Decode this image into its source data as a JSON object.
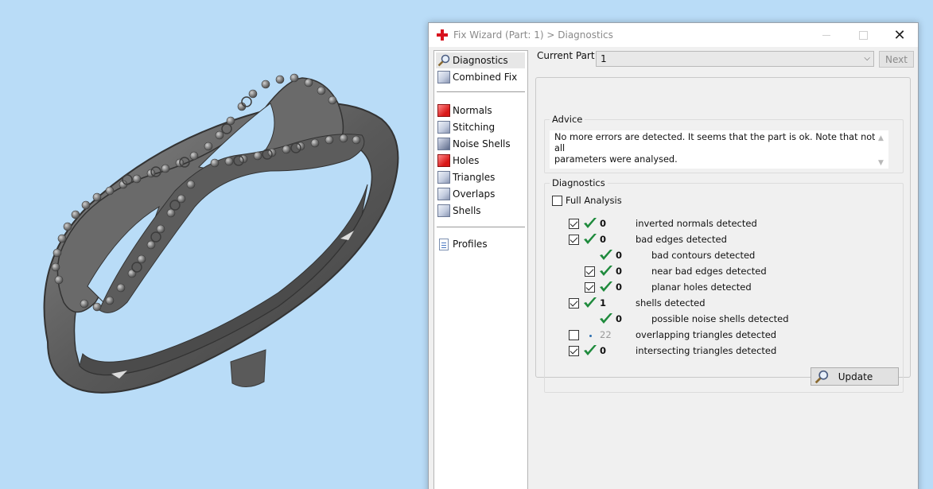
{
  "window": {
    "title": "Fix Wizard (Part: 1) > Diagnostics"
  },
  "nav": {
    "items": [
      {
        "label": "Diagnostics",
        "icon": "magnifier-icon",
        "selected": true
      },
      {
        "label": "Combined Fix",
        "icon": "cube-icon"
      },
      {
        "label": "Normals",
        "icon": "normals-cube-icon"
      },
      {
        "label": "Stitching",
        "icon": "stitching-cube-icon"
      },
      {
        "label": "Noise Shells",
        "icon": "noise-shells-icon"
      },
      {
        "label": "Holes",
        "icon": "holes-cube-icon"
      },
      {
        "label": "Triangles",
        "icon": "triangles-cube-icon"
      },
      {
        "label": "Overlaps",
        "icon": "overlaps-cube-icon"
      },
      {
        "label": "Shells",
        "icon": "shells-cube-icon"
      },
      {
        "label": "Profiles",
        "icon": "document-icon"
      }
    ]
  },
  "current_part": {
    "label": "Current Part:",
    "value": "1"
  },
  "next_label": "Next",
  "advice": {
    "title": "Advice",
    "text_line1": "No more errors are detected. It seems that the part is ok. Note that not all",
    "text_line2": "parameters were analysed."
  },
  "diagnostics": {
    "title": "Diagnostics",
    "full_analysis_label": "Full Analysis",
    "full_analysis_checked": false,
    "rows": [
      {
        "count": "0",
        "label": "inverted normals detected",
        "checked": true
      },
      {
        "count": "0",
        "label": "bad edges detected",
        "checked": true
      },
      {
        "count": "0",
        "label": "bad contours detected"
      },
      {
        "count": "0",
        "label": "near bad edges detected",
        "checked": true
      },
      {
        "count": "0",
        "label": "planar holes detected",
        "checked": true
      },
      {
        "count": "1",
        "label": "shells detected",
        "checked": true
      },
      {
        "count": "0",
        "label": "possible noise shells detected"
      },
      {
        "count": "22",
        "label": "overlapping triangles detected",
        "checked": false
      },
      {
        "count": "0",
        "label": "intersecting triangles detected",
        "checked": true
      }
    ],
    "update_label": "Update"
  },
  "colors": {
    "viewport_bg": "#b9dcf7",
    "model": "#5f5f5f",
    "check_green": "#1e8a3c",
    "close_red": "#d8121e"
  }
}
